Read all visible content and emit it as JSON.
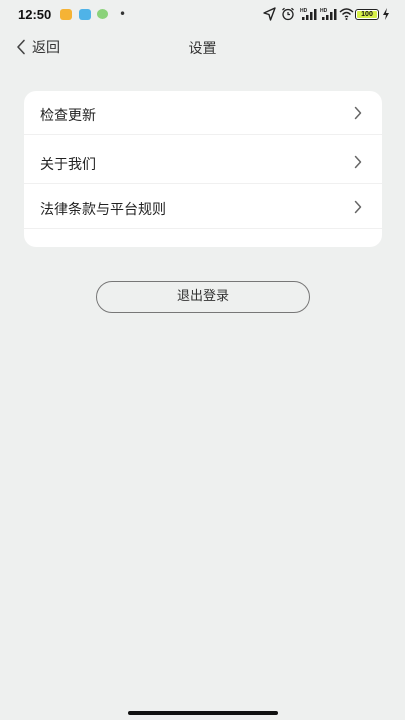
{
  "status_bar": {
    "time": "12:50",
    "battery": "100",
    "network_label": "HD"
  },
  "nav": {
    "back_label": "返回",
    "title": "设置"
  },
  "settings": {
    "items": [
      {
        "label": "检查更新"
      },
      {
        "label": "关于我们"
      },
      {
        "label": "法律条款与平台规则"
      }
    ]
  },
  "logout_label": "退出登录",
  "colors": {
    "background": "#eef0ef",
    "card": "#ffffff",
    "battery_fill": "#d7f04a"
  }
}
